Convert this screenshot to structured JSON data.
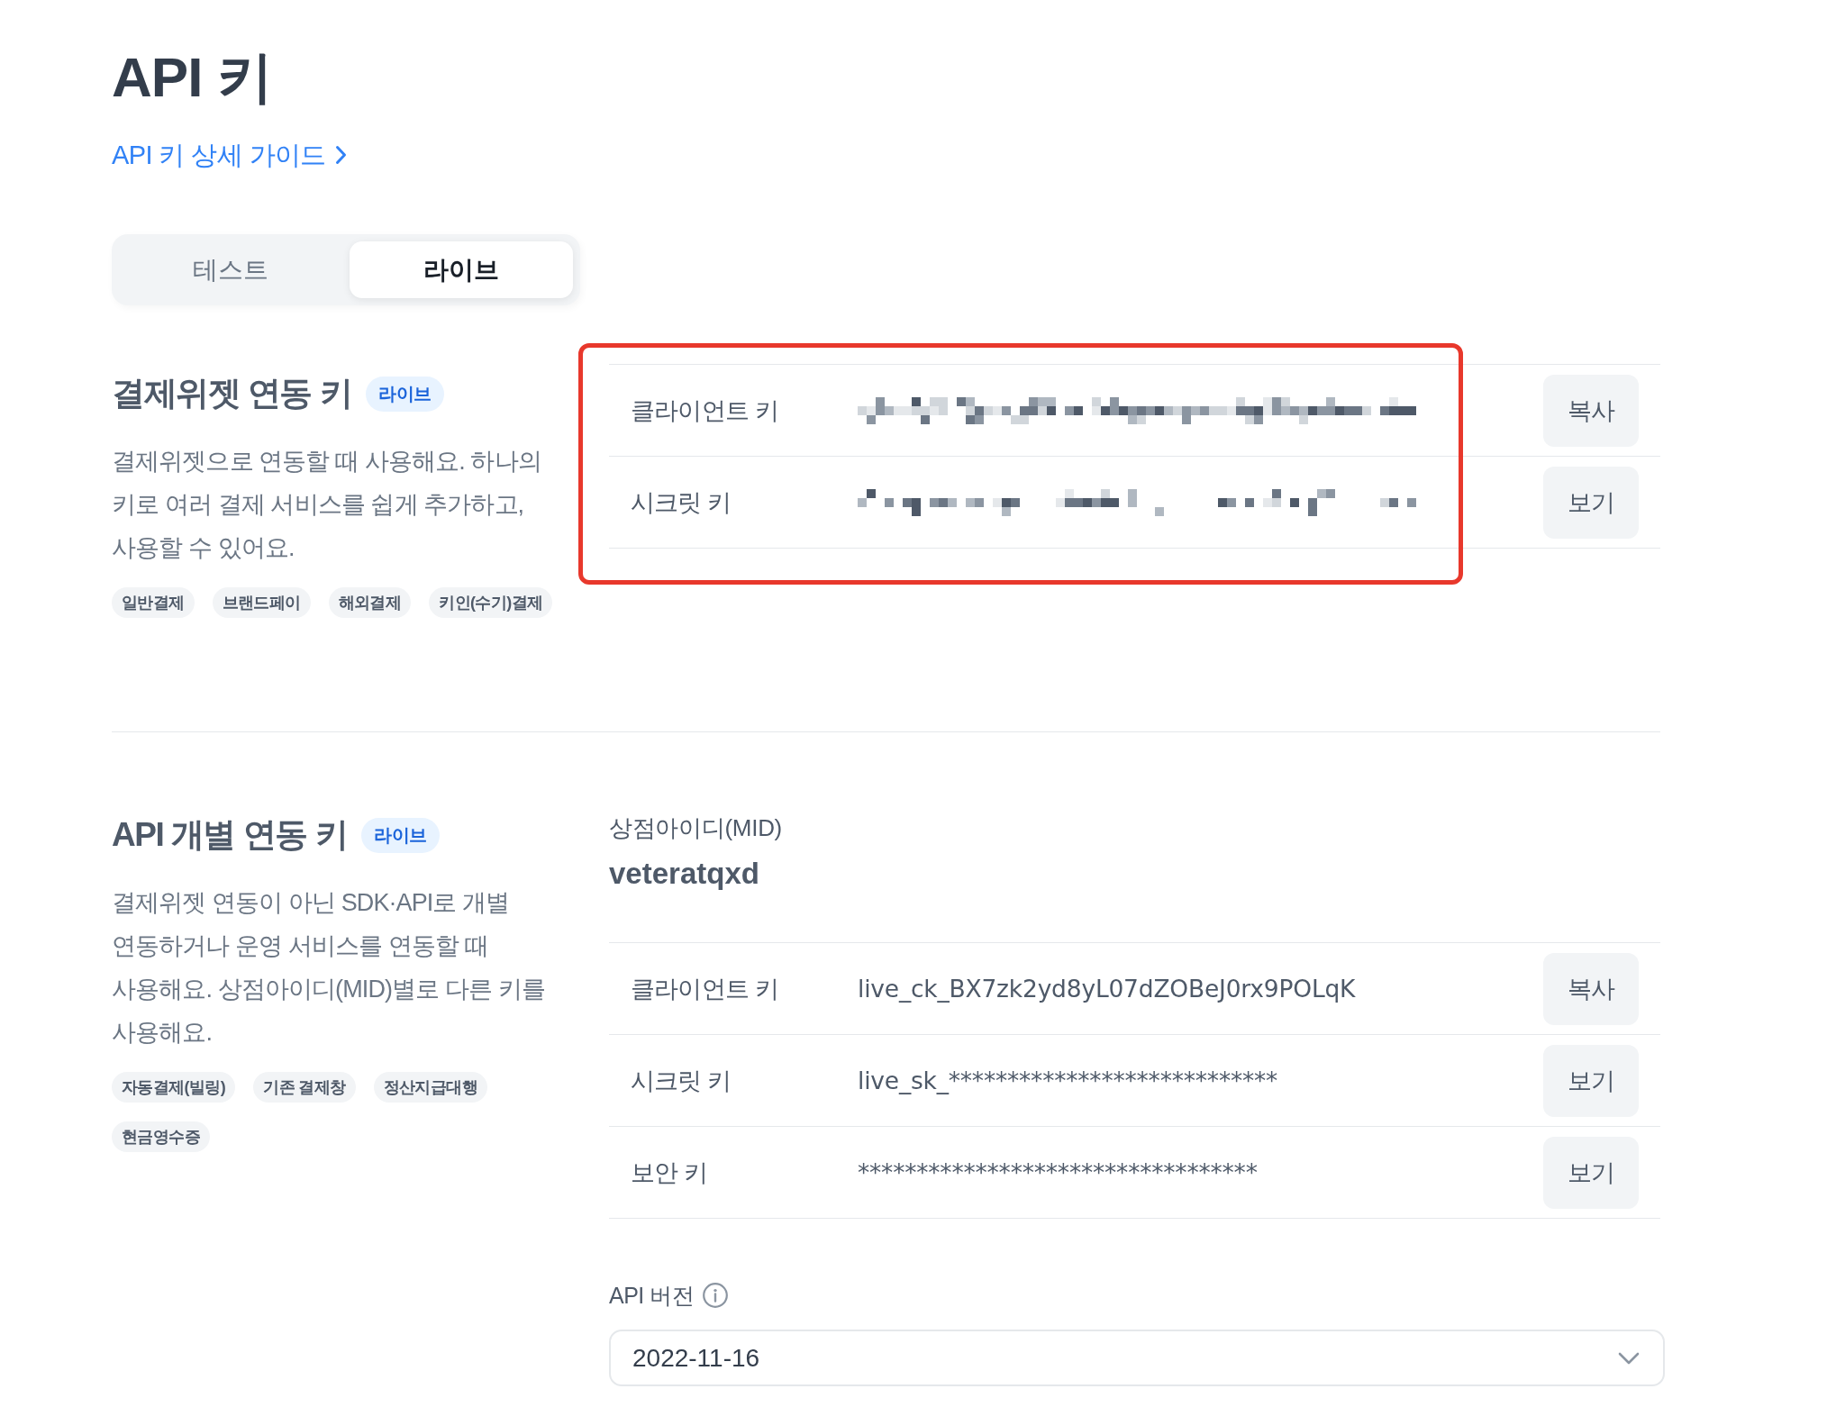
{
  "header": {
    "title": "API 키",
    "guide_link": "API 키 상세 가이드"
  },
  "tabs": [
    {
      "label": "테스트",
      "selected": false
    },
    {
      "label": "라이브",
      "selected": true
    }
  ],
  "sections": [
    {
      "title": "결제위젯 연동 키",
      "badge": "라이브",
      "description": "결제위젯으로 연동할 때 사용해요. 하나의 키로 여러 결제 서비스를 쉽게 추가하고, 사용할 수 있어요.",
      "tags": [
        "일반결제",
        "브랜드페이",
        "해외결제",
        "키인(수기)결제"
      ],
      "highlighted": true,
      "keys": [
        {
          "label": "클라이언트 키",
          "redacted": true,
          "button": "복사"
        },
        {
          "label": "시크릿 키",
          "redacted": true,
          "button": "보기"
        }
      ]
    },
    {
      "title": "API 개별 연동 키",
      "badge": "라이브",
      "description": "결제위젯 연동이 아닌 SDK·API로 개별 연동하거나 운영 서비스를 연동할 때 사용해요. 상점아이디(MID)별로 다른 키를 사용해요.",
      "tags": [
        "자동결제(빌링)",
        "기존 결제창",
        "정산지급대행",
        "현금영수증"
      ],
      "highlighted": false,
      "merchant": {
        "label": "상점아이디(MID)",
        "value": "veteratqxd"
      },
      "keys": [
        {
          "label": "클라이언트 키",
          "redacted": false,
          "value": "live_ck_BX7zk2yd8yL07dZOBeJ0rx9POLqK",
          "button": "복사"
        },
        {
          "label": "시크릿 키",
          "redacted": false,
          "value": "live_sk_****************************",
          "button": "보기"
        },
        {
          "label": "보안 키",
          "redacted": false,
          "value": "**********************************",
          "button": "보기"
        }
      ],
      "api_version": {
        "label": "API 버전",
        "value": "2022-11-16"
      }
    }
  ]
}
